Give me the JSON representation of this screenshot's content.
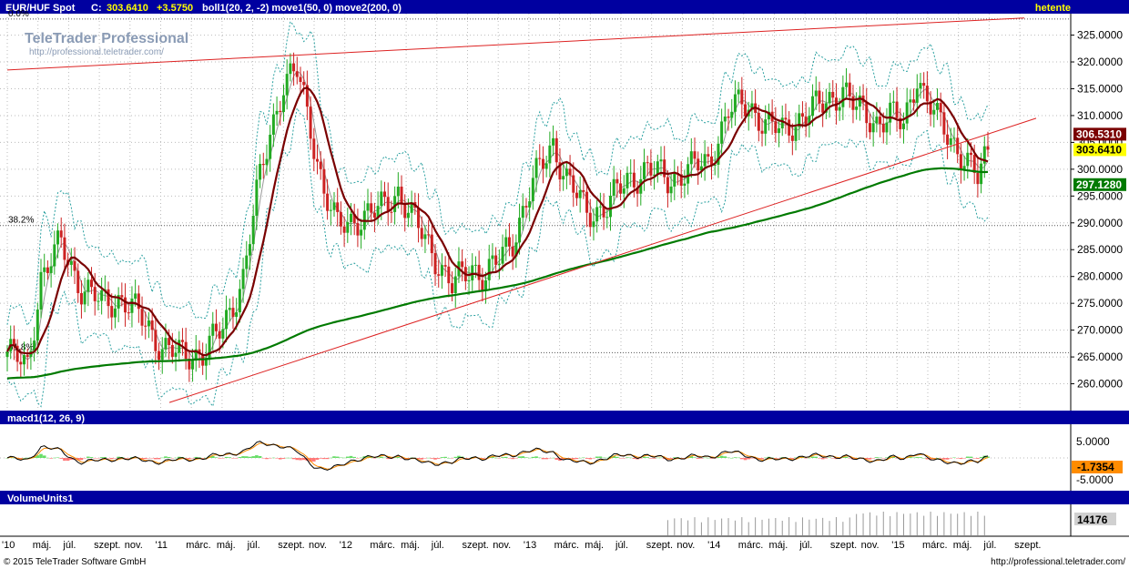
{
  "header": {
    "symbol": "EUR/HUF Spot",
    "close_label": "C:",
    "close_value": "303.6410",
    "change": "+3.5750",
    "indicators": "boll1(20, 2, -2) move1(50, 0) move2(200, 0)",
    "period": "hetente"
  },
  "watermark": {
    "brand": "TeleTrader Professional",
    "url": "http://professional.teletrader.com/"
  },
  "macd_panel": {
    "title": "macd1(12, 26, 9)"
  },
  "volume_panel": {
    "title": "VolumeUnits1"
  },
  "footer": {
    "copyright": "© 2015 TeleTrader Software GmbH",
    "url": "http://professional.teletrader.com/"
  },
  "colors": {
    "header_bg": "#0000a0",
    "up_candle": "#22aa22",
    "down_candle": "#cc2222",
    "ma50": "#7a0000",
    "ma200": "#007a00",
    "bollinger": "#2aa0a0",
    "trendline": "#dd2222",
    "macd": "#000000",
    "signal": "#ff8c00",
    "hist_pos": "#66dd66",
    "hist_neg": "#ff7777"
  },
  "chart_data": {
    "type": "candlestick",
    "interval": "weekly",
    "ylim": [
      255,
      329
    ],
    "yticks": [
      "260.0000",
      "265.0000",
      "270.0000",
      "275.0000",
      "280.0000",
      "285.0000",
      "290.0000",
      "295.0000",
      "300.0000",
      "305.0000",
      "310.0000",
      "315.0000",
      "320.0000",
      "325.0000"
    ],
    "fib_levels": [
      {
        "label": "0.0%",
        "value": 328
      },
      {
        "label": "38.2%",
        "value": 289.5
      },
      {
        "label": "61.8%",
        "value": 265.8
      }
    ],
    "badges": [
      {
        "value": "306.5310",
        "kind": "ma50"
      },
      {
        "value": "303.6410",
        "kind": "last"
      },
      {
        "value": "297.1280",
        "kind": "ma200"
      }
    ],
    "x_labels": [
      "'10",
      "máj.",
      "júl.",
      "szept.",
      "nov.",
      "'11",
      "márc.",
      "máj.",
      "júl.",
      "szept.",
      "nov.",
      "'12",
      "márc.",
      "máj.",
      "júl.",
      "szept.",
      "nov.",
      "'13",
      "márc.",
      "máj.",
      "júl.",
      "szept.",
      "nov.",
      "'14",
      "márc.",
      "máj.",
      "júl.",
      "szept.",
      "nov.",
      "'15",
      "márc.",
      "máj.",
      "júl.",
      "szept."
    ],
    "close_anchors": [
      [
        0,
        266
      ],
      [
        6,
        263
      ],
      [
        10,
        280
      ],
      [
        16,
        286
      ],
      [
        22,
        278
      ],
      [
        28,
        275
      ],
      [
        34,
        276
      ],
      [
        40,
        272
      ],
      [
        46,
        267
      ],
      [
        52,
        265
      ],
      [
        58,
        266
      ],
      [
        64,
        270
      ],
      [
        70,
        280
      ],
      [
        74,
        295
      ],
      [
        78,
        307
      ],
      [
        82,
        316
      ],
      [
        86,
        318
      ],
      [
        90,
        308
      ],
      [
        94,
        296
      ],
      [
        98,
        289
      ],
      [
        104,
        291
      ],
      [
        110,
        292
      ],
      [
        116,
        296
      ],
      [
        120,
        291
      ],
      [
        126,
        285
      ],
      [
        132,
        278
      ],
      [
        138,
        282
      ],
      [
        142,
        280
      ],
      [
        146,
        283
      ],
      [
        150,
        287
      ],
      [
        154,
        294
      ],
      [
        158,
        300
      ],
      [
        162,
        305
      ],
      [
        166,
        298
      ],
      [
        172,
        292
      ],
      [
        178,
        293
      ],
      [
        184,
        298
      ],
      [
        190,
        300
      ],
      [
        196,
        298
      ],
      [
        202,
        300
      ],
      [
        208,
        301
      ],
      [
        214,
        311
      ],
      [
        220,
        312
      ],
      [
        226,
        308
      ],
      [
        230,
        307
      ],
      [
        236,
        310
      ],
      [
        242,
        312
      ],
      [
        248,
        315
      ],
      [
        252,
        311
      ],
      [
        258,
        309
      ],
      [
        262,
        310
      ],
      [
        266,
        308
      ],
      [
        270,
        318
      ],
      [
        272,
        314
      ],
      [
        276,
        309
      ],
      [
        280,
        306
      ],
      [
        284,
        302
      ],
      [
        288,
        298
      ],
      [
        291,
        303.64
      ]
    ],
    "volume_levels": {
      "before_2013_10": 0,
      "after": 14176
    },
    "volume_badge": "14176"
  }
}
